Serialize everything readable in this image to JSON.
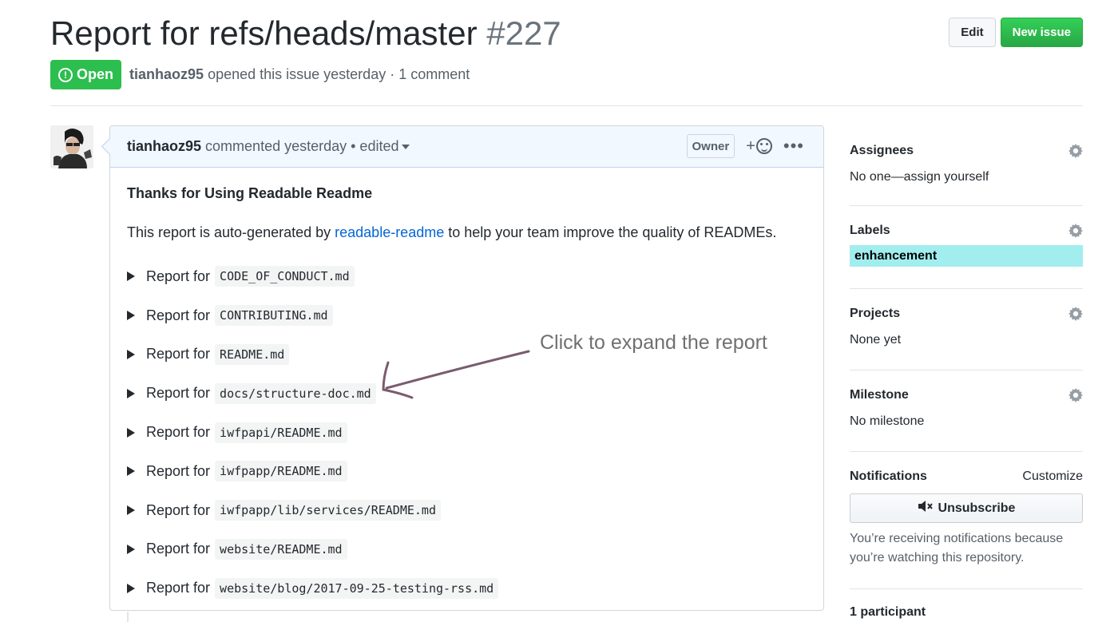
{
  "issue": {
    "title": "Report for refs/heads/master",
    "number": "#227",
    "state": "Open",
    "author": "tianhaoz95",
    "meta_text": "opened this issue yesterday · 1 comment"
  },
  "header_actions": {
    "edit_label": "Edit",
    "new_issue_label": "New issue"
  },
  "comment": {
    "author": "tianhaoz95",
    "meta": "commented yesterday • edited",
    "owner_badge": "Owner",
    "reaction_plus": "+",
    "more": "•••",
    "body_title": "Thanks for Using Readable Readme",
    "intro_before": "This report is auto-generated by ",
    "intro_link": "readable-readme",
    "intro_after": " to help your team improve the quality of READMEs.",
    "report_prefix": "Report for",
    "reports": [
      "CODE_OF_CONDUCT.md",
      "CONTRIBUTING.md",
      "README.md",
      "docs/structure-doc.md",
      "iwfpapi/README.md",
      "iwfpapp/README.md",
      "iwfpapp/lib/services/README.md",
      "website/README.md",
      "website/blog/2017-09-25-testing-rss.md"
    ]
  },
  "annotation": {
    "text": "Click to expand the report"
  },
  "sidebar": {
    "assignees": {
      "title": "Assignees",
      "value": "No one—assign yourself"
    },
    "labels": {
      "title": "Labels",
      "items": [
        "enhancement"
      ],
      "label_color": "#a2eeef"
    },
    "projects": {
      "title": "Projects",
      "value": "None yet"
    },
    "milestone": {
      "title": "Milestone",
      "value": "No milestone"
    },
    "notifications": {
      "title": "Notifications",
      "customize": "Customize",
      "button": "Unsubscribe",
      "note": "You’re receiving notifications because you’re watching this repository."
    },
    "participants": {
      "title": "1 participant"
    }
  },
  "colors": {
    "open_green": "#2cbe4e",
    "link_blue": "#0366d6",
    "header_bg": "#f1f8ff"
  }
}
